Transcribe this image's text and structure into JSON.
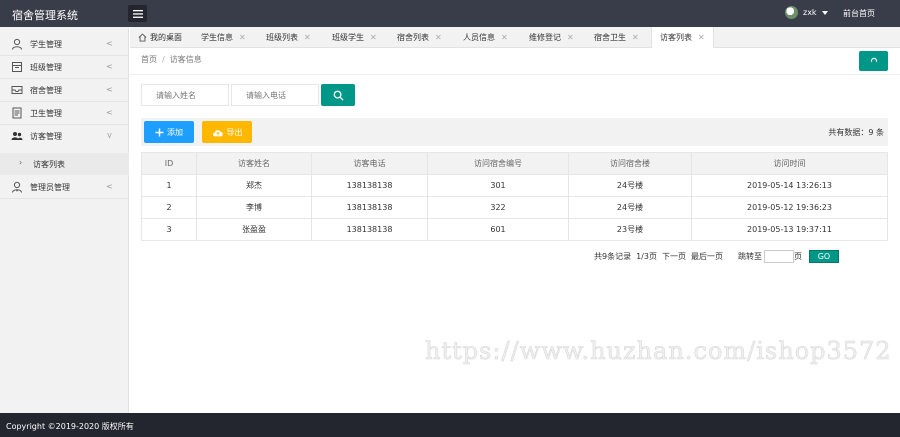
{
  "header": {
    "app_title": "宿舍管理系统",
    "username": "zxk",
    "front_link": "前台首页"
  },
  "sidebar": {
    "items": [
      {
        "label": "学生管理",
        "icon": "user-icon"
      },
      {
        "label": "班级管理",
        "icon": "calendar-icon"
      },
      {
        "label": "宿舍管理",
        "icon": "mail-icon"
      },
      {
        "label": "卫生管理",
        "icon": "document-icon"
      },
      {
        "label": "访客管理",
        "icon": "users-icon"
      },
      {
        "label": "管理员管理",
        "icon": "admin-icon"
      }
    ],
    "sub_item": "访客列表"
  },
  "tabs": [
    {
      "label": "我的桌面",
      "icon": "home-icon"
    },
    {
      "label": "学生信息"
    },
    {
      "label": "班级列表"
    },
    {
      "label": "班级学生"
    },
    {
      "label": "宿舍列表"
    },
    {
      "label": "人员信息"
    },
    {
      "label": "维修登记"
    },
    {
      "label": "宿舍卫生"
    },
    {
      "label": "访客列表",
      "active": true
    }
  ],
  "breadcrumb": {
    "home": "首页",
    "separator": "/",
    "current": "访客信息"
  },
  "search": {
    "name_placeholder": "请输入姓名",
    "phone_placeholder": "请输入电话"
  },
  "toolbar": {
    "add_label": "添加",
    "export_label": "导出",
    "total_text": "共有数据：9 条"
  },
  "table": {
    "headers": [
      "ID",
      "访客姓名",
      "访客电话",
      "访问宿舍编号",
      "访问宿舍楼",
      "访问时间"
    ],
    "rows": [
      [
        "1",
        "郑杰",
        "138138138",
        "301",
        "24号楼",
        "2019-05-14 13:26:13"
      ],
      [
        "2",
        "李博",
        "138138138",
        "322",
        "24号楼",
        "2019-05-12 19:36:23"
      ],
      [
        "3",
        "张盈盈",
        "138138138",
        "601",
        "23号楼",
        "2019-05-13 19:37:11"
      ]
    ]
  },
  "pager": {
    "records": "共9条记录",
    "page_info": "1/3页",
    "next": "下一页",
    "last": "最后一页",
    "jump_prefix": "跳转至",
    "jump_suffix": "页",
    "go": "GO"
  },
  "watermark": "https://www.huzhan.com/ishop3572",
  "footer": {
    "copyright": "Copyright ©2019-2020 版权所有"
  },
  "colors": {
    "topbar": "#393d49",
    "primary": "#009688",
    "blue": "#1e9fff",
    "orange": "#ffb800",
    "footer": "#23262e"
  }
}
